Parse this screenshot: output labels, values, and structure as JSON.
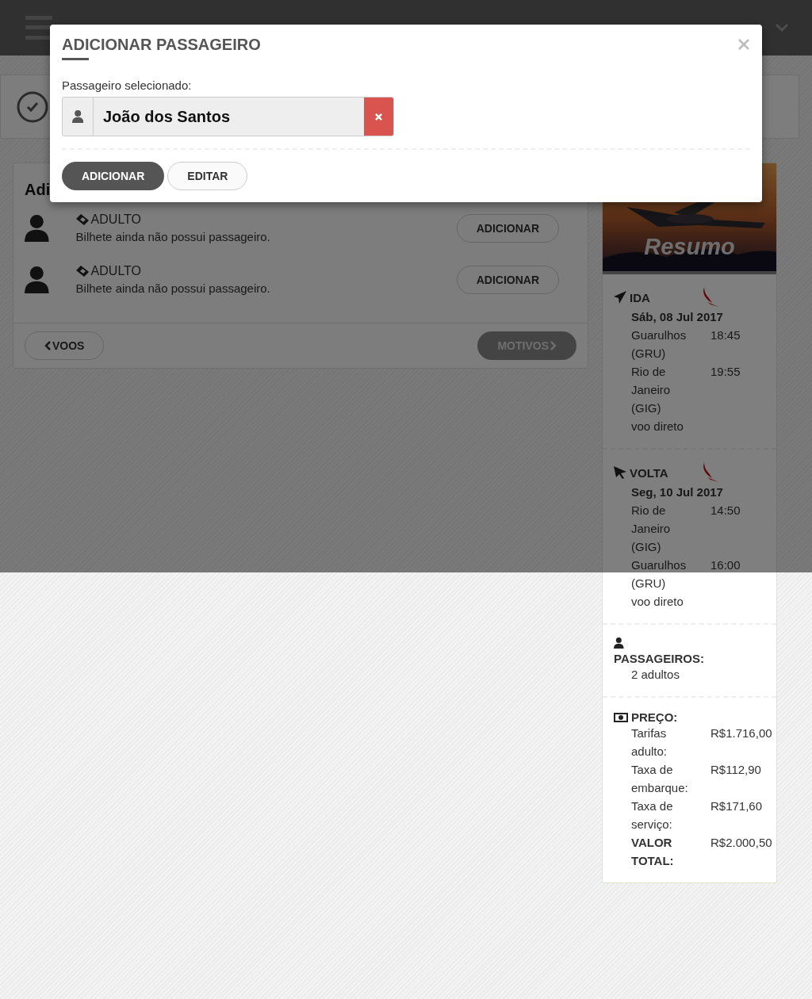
{
  "panel": {
    "title": "Adi",
    "tickets": [
      {
        "type": "ADULTO",
        "status": "Bilhete ainda não possui passageiro.",
        "button": "ADICIONAR"
      },
      {
        "type": "ADULTO",
        "status": "Bilhete ainda não possui passageiro.",
        "button": "ADICIONAR"
      }
    ],
    "back_button": "VOOS",
    "next_button": {
      "label": "MOTIVOS",
      "disabled": true
    }
  },
  "summary": {
    "banner_title": "Resumo",
    "legs": [
      {
        "kind": "outbound",
        "label": "IDA",
        "date": "Sáb, 08 Jul 2017",
        "stops": [
          {
            "place": "Guarulhos (GRU)",
            "time": "18:45"
          },
          {
            "place": "Rio de Janeiro (GIG)",
            "time": "19:55"
          }
        ],
        "note": "voo direto"
      },
      {
        "kind": "return",
        "label": "VOLTA",
        "date": "Seg, 10 Jul 2017",
        "stops": [
          {
            "place": "Rio de Janeiro (GIG)",
            "time": "14:50"
          },
          {
            "place": "Guarulhos (GRU)",
            "time": "16:00"
          }
        ],
        "note": "voo direto"
      }
    ],
    "passengers": {
      "label": "PASSAGEIROS:",
      "value": "2 adultos"
    },
    "price": {
      "label": "PREÇO:",
      "rows": [
        {
          "kind": "item",
          "label": "Tarifas adulto:",
          "value": "R$1.716,00"
        },
        {
          "kind": "item",
          "label": "Taxa de embarque:",
          "value": "R$112,90"
        },
        {
          "kind": "item",
          "label": "Taxa de serviço:",
          "value": "R$171,60"
        },
        {
          "kind": "total",
          "label": "VALOR TOTAL:",
          "value": "R$2.000,50"
        }
      ]
    }
  },
  "modal": {
    "title": "ADICIONAR PASSAGEIRO",
    "field_label": "Passageiro selecionado:",
    "passenger": "João dos Santos",
    "buttons": [
      {
        "kind": "primary",
        "label": "ADICIONAR"
      },
      {
        "kind": "default",
        "label": "EDITAR"
      }
    ]
  }
}
